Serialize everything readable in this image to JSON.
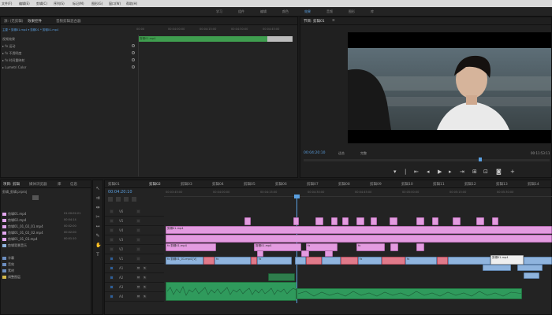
{
  "menu": {
    "items": [
      "文件(F)",
      "编辑(E)",
      "剪辑(C)",
      "序列(S)",
      "标记(M)",
      "图形(G)",
      "窗口(W)",
      "帮助(H)"
    ]
  },
  "workspaces": {
    "items": [
      "学习",
      "组件",
      "编辑",
      "颜色",
      "效果",
      "音频",
      "图形",
      "库"
    ],
    "active_index": 4
  },
  "effects_panel": {
    "tabs": [
      "源: (无剪辑)",
      "效果控件",
      "音频剪辑混合器"
    ],
    "active_tab": 1,
    "clip_selector": "主要 * 剪辑01.mp4 ▾ 剪辑01 * 剪辑01.mp4",
    "clip_bar_label": "剪辑01.mp4",
    "rows": [
      "视频效果",
      "▸ fx 运动",
      "▸ fx 不透明度",
      "▸ fx 时间重映射",
      "▸ Lumetri Color"
    ],
    "ruler": [
      "00:00",
      "00:04:00:00",
      "00:04:15:00",
      "00:04:30:00",
      "00:04:45:00"
    ]
  },
  "program_monitor": {
    "tabs": [
      "节目: 剪辑01",
      "≡"
    ],
    "timecode": "00:04:20:10",
    "fit": "适合",
    "quality": "完整",
    "duration": "00:11:53:11",
    "transport": [
      "标记入点",
      "标记出点",
      "转到入点",
      "后退一帧",
      "播放",
      "前进一帧",
      "转到出点",
      "插入",
      "覆盖",
      "导出帧"
    ]
  },
  "project_panel": {
    "tabs": [
      "项目: 剪辑",
      "媒体浏览器",
      "库",
      "信息"
    ],
    "project_name": "剪辑_剪辑.prproj",
    "items": [
      {
        "name": "剪辑01.mp4",
        "dur": "01:20:02:21"
      },
      {
        "name": "剪辑02.mp4",
        "dur": "00:04:14"
      },
      {
        "name": "剪辑01_01_02_01.mp4",
        "dur": "00:02:00"
      },
      {
        "name": "剪辑01_01_02_02.mp4",
        "dur": "00:02:00"
      },
      {
        "name": "剪辑01_01_03.mp4",
        "dur": "00:01:10"
      },
      {
        "name": "剪辑背景音乐",
        "dur": ""
      },
      {
        "name": "字幕",
        "dur": ""
      },
      {
        "name": "音效",
        "dur": ""
      },
      {
        "name": "素材",
        "dur": ""
      },
      {
        "name": "调整图层",
        "dur": ""
      }
    ],
    "colors": [
      "#e3a6f0",
      "#e3a6f0",
      "#e3a6f0",
      "#e3a6f0",
      "#e3a6f0",
      "#8fb4de",
      "#6c8ec0",
      "#6c8ec0",
      "#6c8ec0",
      "#d4b84a"
    ]
  },
  "timeline": {
    "tabs": [
      "剪辑01",
      "剪辑02",
      "剪辑03",
      "剪辑04",
      "剪辑05",
      "剪辑06",
      "剪辑07",
      "剪辑08",
      "剪辑09",
      "剪辑10",
      "剪辑11",
      "剪辑12",
      "剪辑13",
      "剪辑14"
    ],
    "active_tab": 1,
    "timecode": "00:04:20:10",
    "ruler": [
      "00:03:45:00",
      "00:04:00:00",
      "00:04:15:00",
      "00:04:30:00",
      "00:04:45:00",
      "00:05:00:00",
      "00:05:15:00",
      "00:05:30:00"
    ],
    "tracks": [
      "V6",
      "V5",
      "V4",
      "V3",
      "V2",
      "V1",
      "A1",
      "A2",
      "A3",
      "A4"
    ],
    "clip_labels": {
      "pink_long": "剪辑01.mp4",
      "v2_left": "fx 剪辑01.mp4",
      "v1_left": "fx 剪辑01_01.mp4 [V]",
      "v1_white": "剪辑01.mp4",
      "short": "fx"
    }
  }
}
